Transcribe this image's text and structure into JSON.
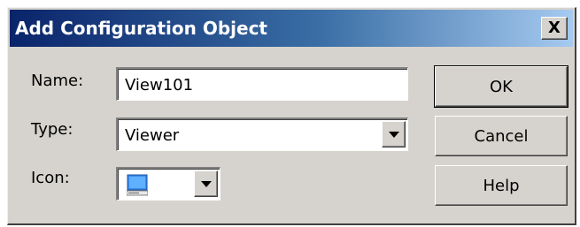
{
  "window": {
    "title": "Add Configuration Object",
    "close_label": "X"
  },
  "fields": {
    "name": {
      "label": "Name:",
      "value": "View101"
    },
    "type": {
      "label": "Type:",
      "value": "Viewer"
    },
    "icon": {
      "label": "Icon:",
      "icon_name": "monitor-icon"
    }
  },
  "buttons": {
    "ok": "OK",
    "cancel": "Cancel",
    "help": "Help"
  },
  "colors": {
    "title_gradient_start": "#0a246a",
    "title_gradient_end": "#a6caf0",
    "face": "#d6d3ce"
  }
}
